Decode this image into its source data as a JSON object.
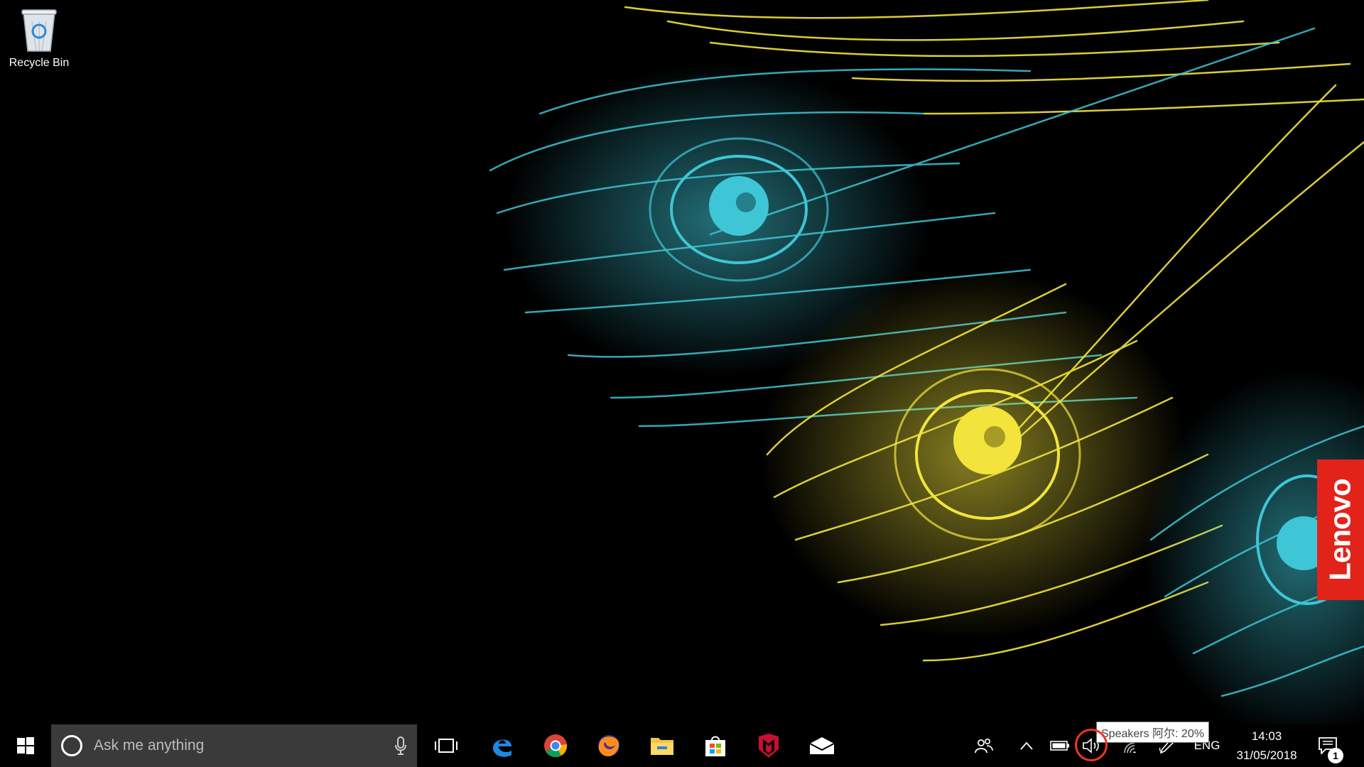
{
  "desktop": {
    "icons": [
      {
        "label": "Recycle Bin"
      }
    ],
    "brand_tab": "Lenovo"
  },
  "taskbar": {
    "search_placeholder": "Ask me anything",
    "pinned_apps": [
      {
        "name": "Microsoft Edge",
        "icon": "edge-icon"
      },
      {
        "name": "Google Chrome",
        "icon": "chrome-icon"
      },
      {
        "name": "Firefox",
        "icon": "firefox-icon"
      },
      {
        "name": "File Explorer",
        "icon": "folder-icon"
      },
      {
        "name": "Microsoft Store",
        "icon": "store-icon"
      },
      {
        "name": "McAfee",
        "icon": "mcafee-icon"
      },
      {
        "name": "Mail",
        "icon": "mail-icon"
      }
    ],
    "tray": {
      "language": "ENG",
      "time": "14:03",
      "date": "31/05/2018",
      "notification_count": "1",
      "volume_tooltip": "Speakers 阿尔: 20%"
    }
  },
  "colors": {
    "taskbar": "#000000",
    "search_box": "#3a3a3a",
    "feather_cyan": "#3ec6d6",
    "feather_yellow": "#f2e43c",
    "lenovo_red": "#e2231a",
    "highlight": "#e33322"
  }
}
